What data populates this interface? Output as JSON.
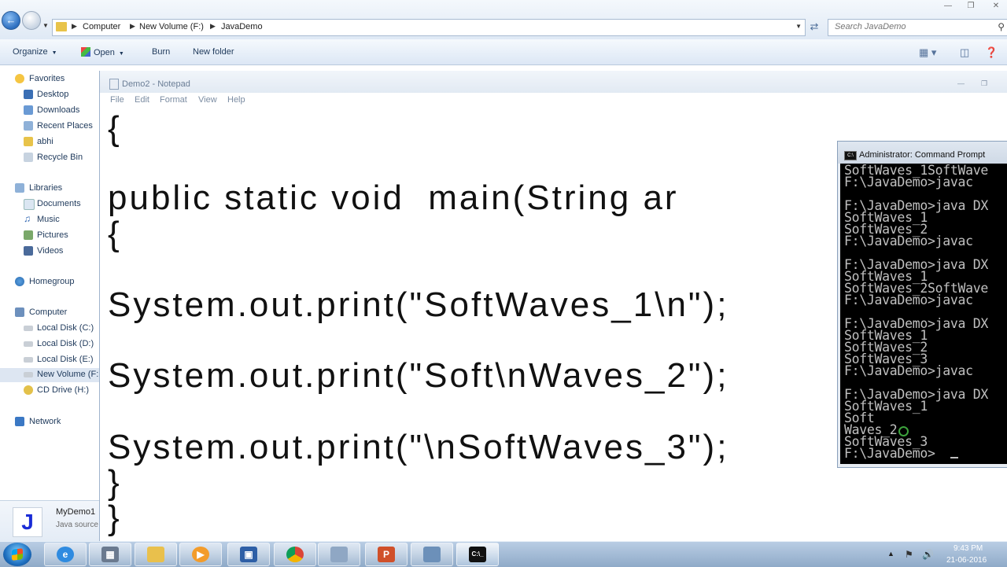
{
  "explorer": {
    "breadcrumbs": [
      "Computer",
      "New Volume (F:)",
      "JavaDemo"
    ],
    "search_placeholder": "Search JavaDemo",
    "toolbar": {
      "organize": "Organize",
      "open": "Open",
      "burn": "Burn",
      "new_folder": "New folder"
    },
    "nav": {
      "favorites": "Favorites",
      "desktop": "Desktop",
      "downloads": "Downloads",
      "recent_places": "Recent Places",
      "abhi": "abhi",
      "recycle_bin": "Recycle Bin",
      "libraries": "Libraries",
      "documents": "Documents",
      "music": "Music",
      "pictures": "Pictures",
      "videos": "Videos",
      "homegroup": "Homegroup",
      "computer": "Computer",
      "local_c": "Local Disk (C:)",
      "local_d": "Local Disk (D:)",
      "local_e": "Local Disk (E:)",
      "new_volume": "New Volume (F:",
      "cd_drive": "CD Drive (H:)",
      "network": "Network"
    },
    "details": {
      "name": "MyDemo1",
      "type": "Java source"
    }
  },
  "notepad": {
    "title": "Demo2 - Notepad",
    "menu": [
      "File",
      "Edit",
      "Format",
      "View",
      "Help"
    ],
    "lines": [
      "{",
      "public static void  main(String ar",
      "{",
      "System.out.print(\"SoftWaves_1\\n\");",
      "System.out.print(\"Soft\\nWaves_2\");",
      "System.out.print(\"\\nSoftWaves_3\");",
      "}",
      "}"
    ]
  },
  "cmd": {
    "title": "Administrator: Command Prompt",
    "lines": [
      "SoftWaves_1SoftWave",
      "F:\\JavaDemo>javac",
      "",
      "F:\\JavaDemo>java DX",
      "SoftWaves_1",
      "SoftWaves_2",
      "F:\\JavaDemo>javac",
      "",
      "F:\\JavaDemo>java DX",
      "SoftWaves_1",
      "SoftWaves_2SoftWave",
      "F:\\JavaDemo>javac",
      "",
      "F:\\JavaDemo>java DX",
      "SoftWaves_1",
      "SoftWaves_2",
      "SoftWaves_3",
      "F:\\JavaDemo>javac",
      "",
      "F:\\JavaDemo>java DX",
      "SoftWaves_1",
      "Soft",
      "Waves_2",
      "SoftWaves_3",
      "F:\\JavaDemo>"
    ]
  },
  "taskbar": {
    "time": "9:43 PM",
    "date": "21-06-2016",
    "apps": [
      "ie-icon",
      "calculator-icon",
      "explorer-icon",
      "media-player-icon",
      "remote-desktop-icon",
      "chrome-icon",
      "notepad-icon",
      "powerpoint-icon",
      "network-icon",
      "cmd-icon"
    ]
  },
  "colors": {
    "cmd_background": "#000000",
    "cmd_text": "#c0c0c0",
    "taskbar": "#9fb8d6",
    "chrome_blue": "#1e395b"
  }
}
